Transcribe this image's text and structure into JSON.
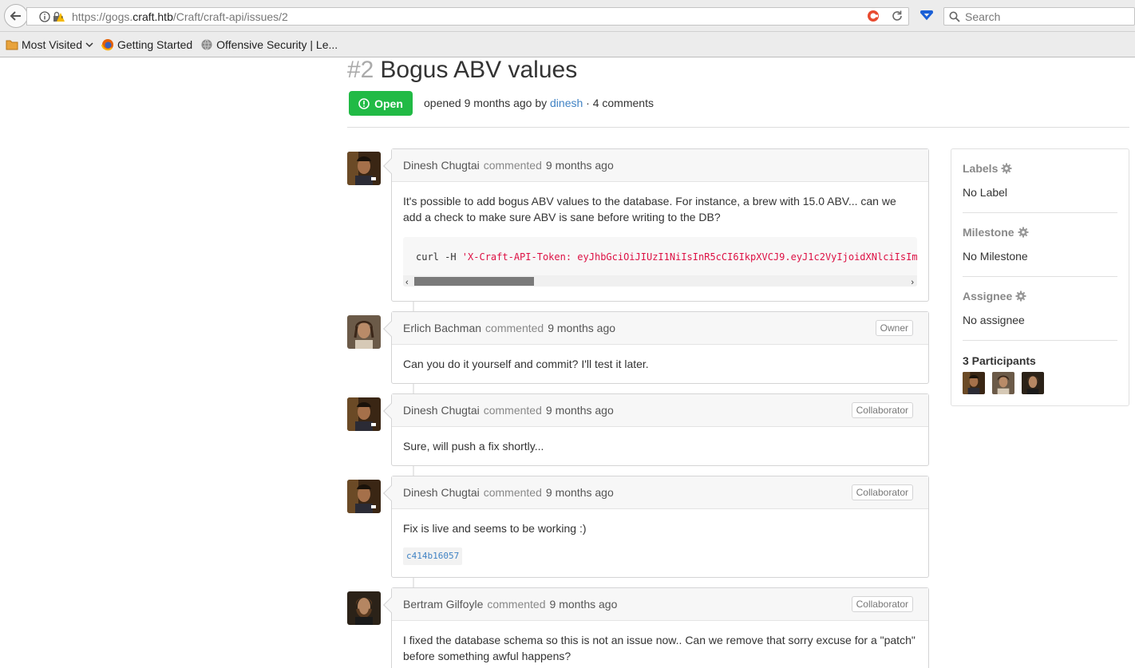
{
  "browser": {
    "url_prefix": "https://gogs.",
    "url_host": "craft.htb",
    "url_path": "/Craft/craft-api/issues/2",
    "search_placeholder": "Search",
    "bookmarks": [
      {
        "label": "Most Visited",
        "icon": "folder-icon"
      },
      {
        "label": "Getting Started",
        "icon": "firefox-icon"
      },
      {
        "label": "Offensive Security | Le...",
        "icon": "globe-icon"
      }
    ]
  },
  "issue": {
    "number": "#2",
    "title": "Bogus ABV values",
    "status": "Open",
    "meta_prefix": "opened 9 months ago by",
    "author": "dinesh",
    "meta_suffix": "· 4 comments"
  },
  "comments": [
    {
      "author": "Dinesh Chugtai",
      "action": "commented",
      "time": "9 months ago",
      "role": "",
      "body": "It's possible to add bogus ABV values to the database. For instance, a brew with 15.0 ABV... can we add a check to make sure ABV is sane before writing to the DB?",
      "code_cmd": "curl -H ",
      "code_str": "'X-Craft-API-Token: eyJhbGciOiJIUzI1NiIsInR5cCI6IkpXVCJ9.eyJ1c2VyIjoidXNlciIsImV4cCI6MTU0OTM4NTI0Mn0.-wW1aJkLQDOE-GP5pQd3z_BJTe2Uo0jJ_mQ238P5Dqw' -H 'Content-Type: application/json' -k -X POST https://api.craft.htb/api/brew/"
    },
    {
      "author": "Erlich Bachman",
      "action": "commented",
      "time": "9 months ago",
      "role": "Owner",
      "body": "Can you do it yourself and commit? I'll test it later."
    },
    {
      "author": "Dinesh Chugtai",
      "action": "commented",
      "time": "9 months ago",
      "role": "Collaborator",
      "body": "Sure, will push a fix shortly..."
    },
    {
      "author": "Dinesh Chugtai",
      "action": "commented",
      "time": "9 months ago",
      "role": "Collaborator",
      "body": "Fix is live and seems to be working :)",
      "commit": "c414b16057"
    },
    {
      "author": "Bertram Gilfoyle",
      "action": "commented",
      "time": "9 months ago",
      "role": "Collaborator",
      "body": "I fixed the database schema so this is not an issue now.. Can we remove that sorry excuse for a \"patch\" before something awful happens?"
    }
  ],
  "sidebar": {
    "labels_head": "Labels",
    "labels_value": "No Label",
    "milestone_head": "Milestone",
    "milestone_value": "No Milestone",
    "assignee_head": "Assignee",
    "assignee_value": "No assignee",
    "participants_head": "3 Participants"
  },
  "colors": {
    "open_green": "#21ba45",
    "link_blue": "#4183c4",
    "code_string": "#d14"
  }
}
